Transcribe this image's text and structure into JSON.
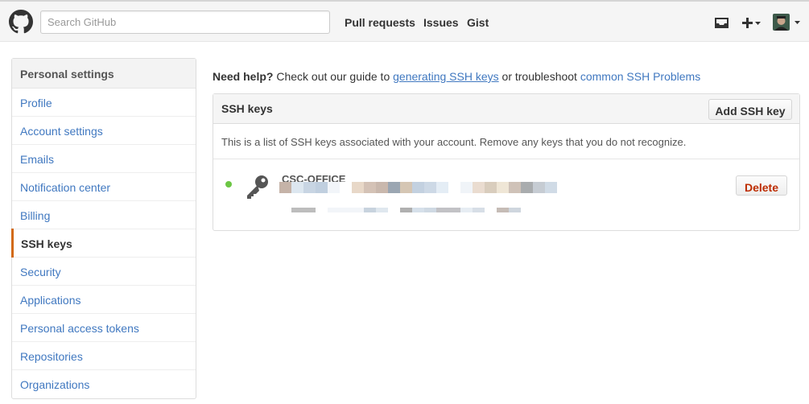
{
  "header": {
    "search_placeholder": "Search GitHub",
    "nav": [
      "Pull requests",
      "Issues",
      "Gist"
    ],
    "icons": [
      "octocat-logo-icon",
      "inbox-icon",
      "plus-icon",
      "avatar"
    ]
  },
  "sidebar": {
    "title": "Personal settings",
    "items": [
      {
        "label": "Profile"
      },
      {
        "label": "Account settings"
      },
      {
        "label": "Emails"
      },
      {
        "label": "Notification center"
      },
      {
        "label": "Billing"
      },
      {
        "label": "SSH keys",
        "selected": true
      },
      {
        "label": "Security"
      },
      {
        "label": "Applications"
      },
      {
        "label": "Personal access tokens"
      },
      {
        "label": "Repositories"
      },
      {
        "label": "Organizations"
      }
    ]
  },
  "help": {
    "lead": "Need help?",
    "text1": " Check out our guide to ",
    "link1": "generating SSH keys",
    "text2": " or troubleshoot ",
    "link2": "common SSH Problems"
  },
  "ssh": {
    "title": "SSH keys",
    "add_label": "Add SSH key",
    "description": "This is a list of SSH keys associated with your account. Remove any keys that you do not recognize.",
    "keys": [
      {
        "title": "CSC-OFFICE",
        "status": "active",
        "delete_label": "Delete"
      }
    ]
  },
  "colors": {
    "link": "#4078c0",
    "selected_marker": "#d26911",
    "active_dot": "#6cc644",
    "delete": "#bd2c00"
  }
}
